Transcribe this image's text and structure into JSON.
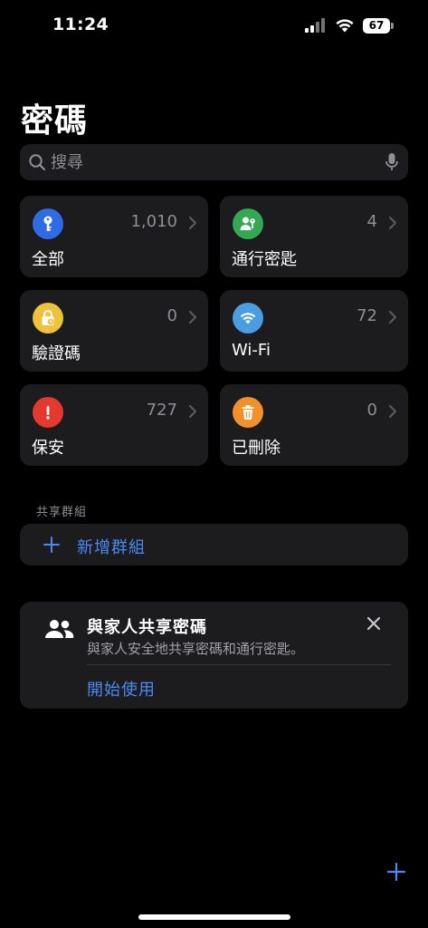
{
  "status_bar": {
    "time": "11:24",
    "battery": "67"
  },
  "page": {
    "title": "密碼"
  },
  "search": {
    "placeholder": "搜尋",
    "value": ""
  },
  "categories": [
    {
      "label": "全部",
      "count": "1,010",
      "icon": "key-icon",
      "color": "#2f6be4"
    },
    {
      "label": "通行密匙",
      "count": "4",
      "icon": "person-key-icon",
      "color": "#34a853"
    },
    {
      "label": "驗證碼",
      "count": "0",
      "icon": "lock-clock-icon",
      "color": "#f0c23b"
    },
    {
      "label": "Wi-Fi",
      "count": "72",
      "icon": "wifi-icon",
      "color": "#4a9ee0"
    },
    {
      "label": "保安",
      "count": "727",
      "icon": "exclamation-icon",
      "color": "#e3392f"
    },
    {
      "label": "已刪除",
      "count": "0",
      "icon": "trash-icon",
      "color": "#f0912b"
    }
  ],
  "shared_groups": {
    "header": "共享群組",
    "new_group_label": "新增群組"
  },
  "family_sharing": {
    "title": "與家人共享密碼",
    "subtitle": "與家人安全地共享密碼和通行密匙。",
    "action_label": "開始使用"
  },
  "colors": {
    "background": "#000000",
    "card": "#1c1c1e",
    "accent": "#4a8af4",
    "secondary_text": "#8e8e93"
  }
}
